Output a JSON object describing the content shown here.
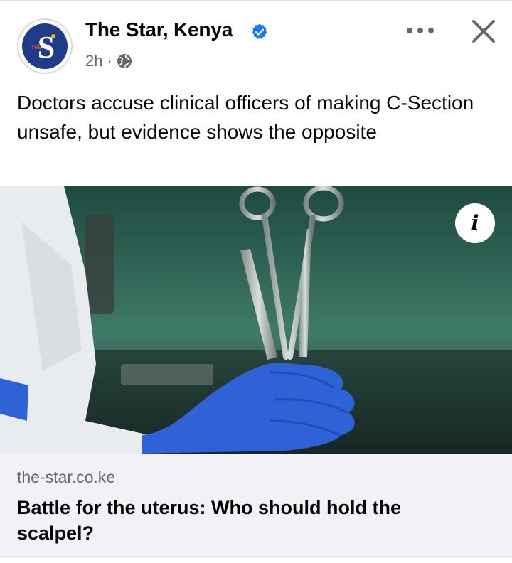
{
  "post": {
    "page_name": "The Star, Kenya",
    "verified": true,
    "time": "2h",
    "separator": "·",
    "audience_icon": "globe-icon",
    "text": "Doctors accuse clinical officers of making C-Section unsafe, but evidence shows the opposite"
  },
  "avatar": {
    "letter": "S",
    "small_text": "THE"
  },
  "actions": {
    "more_icon": "more-options-icon",
    "close_icon": "close-icon"
  },
  "image": {
    "info_label": "i"
  },
  "link": {
    "domain": "the-star.co.ke",
    "headline": "Battle for the uterus: Who should hold the scalpel?"
  },
  "colors": {
    "brand_navy": "#1f3c88",
    "verified_blue": "#1877f2",
    "secondary_text": "#65676b",
    "link_card_bg": "#f0f2f5",
    "glove_blue": "#2f62d6"
  }
}
